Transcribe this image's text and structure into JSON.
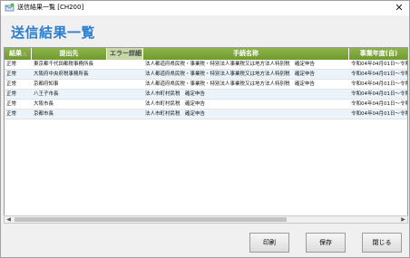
{
  "window": {
    "title": "送信結果一覧 [CH200]",
    "close_glyph": "✕"
  },
  "page_title": "送信結果一覧",
  "table": {
    "columns": [
      "結果",
      "提出先",
      "エラー詳細",
      "手続名称",
      "事業年度(自)"
    ],
    "rows": [
      [
        "正常",
        "東京都千代田都税事務所長",
        "",
        "法人都道府県民税・事業税・特別法人事業税又は地方法人特別税　確定申告",
        "令和04年04月01日～令和"
      ],
      [
        "正常",
        "大阪府中央府税事務所長",
        "",
        "法人都道府県民税・事業税・特別法人事業税又は地方法人特別税　確定申告",
        "令和04年04月01日～令和"
      ],
      [
        "正常",
        "京都府知事",
        "",
        "法人都道府県民税・事業税・特別法人事業税又は地方法人特別税　確定申告",
        "令和04年04月01日～令和"
      ],
      [
        "正常",
        "八王子市長",
        "",
        "法人市町村民税　確定申告",
        "令和04年04月01日～令和"
      ],
      [
        "正常",
        "大阪市長",
        "",
        "法人市町村民税　確定申告",
        "令和04年04月01日～令和"
      ],
      [
        "正常",
        "京都市長",
        "",
        "法人市町村民税　確定申告",
        "令和04年04月01日～令和"
      ]
    ]
  },
  "buttons": {
    "print": "印刷",
    "save": "保存",
    "close": "閉じる"
  },
  "colors": {
    "title_blue": "#2c7fd0",
    "header_green": "#7ea83c",
    "row_alt": "#ebf4fb"
  }
}
